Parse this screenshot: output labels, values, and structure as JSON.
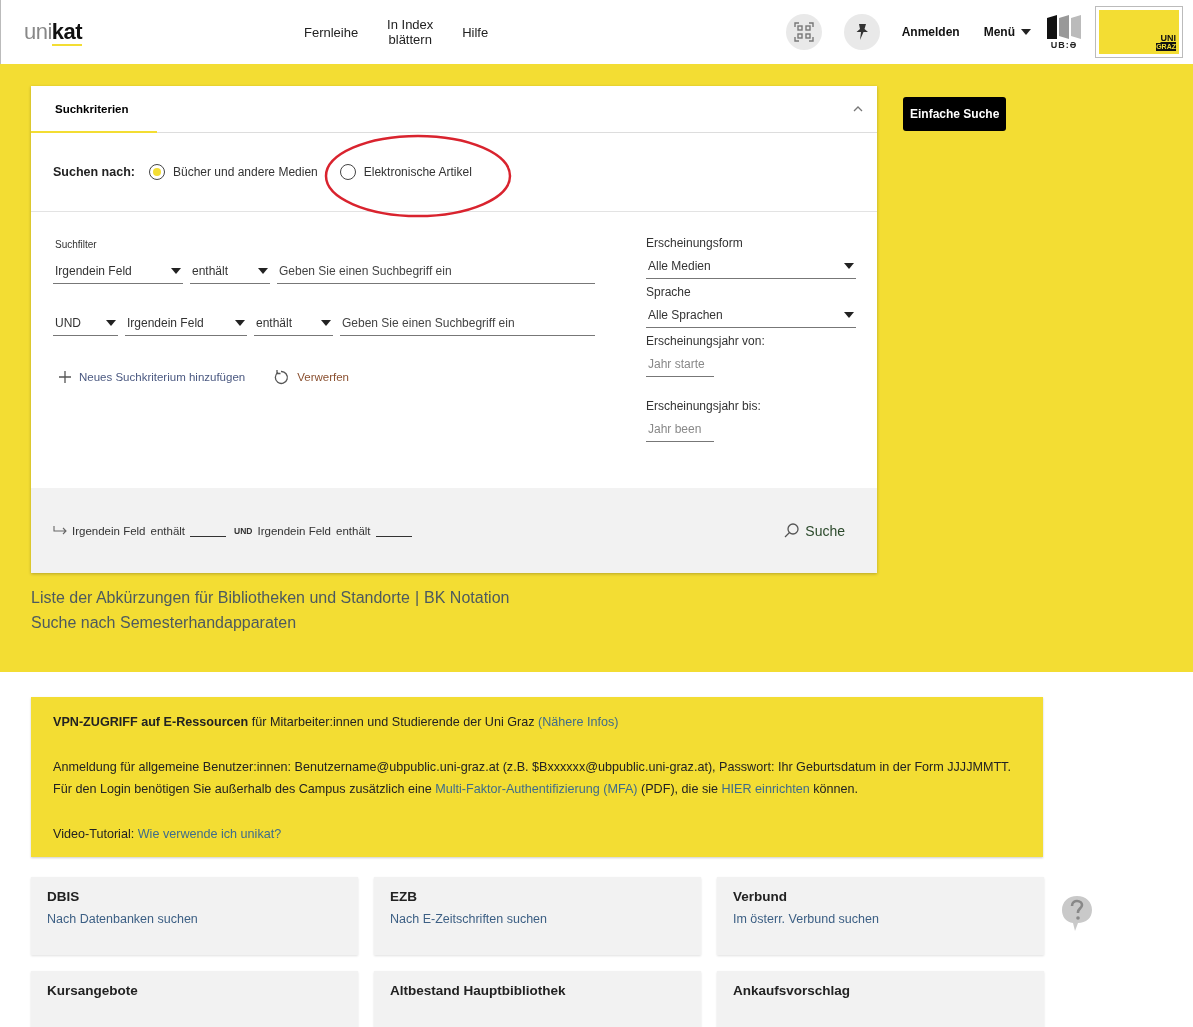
{
  "header": {
    "logo": {
      "light": "uni",
      "bold": "kat"
    },
    "nav": [
      "Fernleihe",
      "In Index blättern",
      "Hilfe"
    ],
    "login": "Anmelden",
    "menu": "Menü",
    "library_logo": "UB:Ə",
    "university_logo": {
      "line_1": "UNI",
      "line_2": "GRAZ"
    }
  },
  "search_card": {
    "tabs": [
      {
        "label": "Suchkriterien",
        "selected": true
      }
    ],
    "expanded": true,
    "search_for": {
      "label": "Suchen nach:",
      "options": [
        {
          "label": "Bücher und andere Medien",
          "selected": true,
          "highlighted": false
        },
        {
          "label": "Elektronische Artikel",
          "selected": false,
          "highlighted": true
        }
      ]
    },
    "filter_label": "Suchfilter",
    "filter_rows": [
      [
        {
          "kind": "select",
          "value": "Irgendein Feld"
        },
        {
          "kind": "select",
          "value": "enthält"
        },
        {
          "kind": "input",
          "placeholder": "Geben Sie einen Suchbegriff ein"
        }
      ],
      [
        {
          "kind": "select",
          "value": "UND"
        },
        {
          "kind": "select",
          "value": "Irgendein Feld"
        },
        {
          "kind": "select",
          "value": "enthält"
        },
        {
          "kind": "input",
          "placeholder": "Geben Sie einen Suchbegriff ein"
        }
      ]
    ],
    "add_criterion": "Neues Suchkriterium hinzufügen",
    "reset": "Verwerfen",
    "facets": [
      {
        "kind": "select",
        "label": "Erscheinungsform",
        "value": "Alle Medien"
      },
      {
        "kind": "select",
        "label": "Sprache",
        "value": "Alle Sprachen"
      },
      {
        "kind": "input",
        "label": "Erscheinungsjahr von:",
        "placeholder": "Jahr starte"
      },
      {
        "kind": "input",
        "label": "Erscheinungsjahr bis:",
        "placeholder": "Jahr been"
      }
    ],
    "summary": [
      {
        "kind": "text",
        "text": "Irgendein Feld"
      },
      {
        "kind": "text",
        "text": "enthält"
      },
      {
        "kind": "blank"
      },
      {
        "kind": "operator",
        "text": "UND"
      },
      {
        "kind": "text",
        "text": "Irgendein Feld"
      },
      {
        "kind": "text",
        "text": "enthält"
      },
      {
        "kind": "blank"
      }
    ],
    "search_button": "Suche"
  },
  "simple_search_button": "Einfache Suche",
  "links": [
    [
      {
        "kind": "link",
        "text": "Liste der Abkürzungen für Bibliotheken und Standorte"
      },
      {
        "kind": "separator",
        "text": "|"
      },
      {
        "kind": "link",
        "text": "BK Notation"
      }
    ],
    [
      {
        "kind": "link",
        "text": "Suche nach Semesterhandapparaten"
      }
    ]
  ],
  "info": [
    [
      {
        "kind": "text",
        "text": "**VPN-ZUGRIFF auf E-Ressourcen** für Mitarbeiter:innen und Studierende der Uni Graz "
      },
      {
        "kind": "link",
        "text": "(Nähere Infos)"
      }
    ],
    [
      {
        "kind": "text",
        "text": "Anmeldung für allgemeine Benutzer:innen: Benutzername@ubpublic.uni-graz.at (z.B. $Bxxxxxx@ubpublic.uni-graz.at), Passwort: Ihr Geburtsdatum in der Form JJJJMMTT. Für den Login benötigen Sie außerhalb des Campus zusätzlich eine "
      },
      {
        "kind": "link",
        "text": "Multi-Faktor-Authentifizierung (MFA)"
      },
      {
        "kind": "text",
        "text": " (PDF), die sie "
      },
      {
        "kind": "link",
        "text": "HIER einrichten"
      },
      {
        "kind": "text",
        "text": " können."
      }
    ],
    [
      {
        "kind": "text",
        "text": "Video-Tutorial: "
      },
      {
        "kind": "link",
        "text": "Wie verwende ich unikat?"
      }
    ]
  ],
  "tiles": [
    {
      "title": "DBIS",
      "link": "Nach Datenbanken suchen"
    },
    {
      "title": "EZB",
      "link": "Nach E-Zeitschriften suchen"
    },
    {
      "title": "Verbund",
      "link": "Im österr. Verbund suchen"
    },
    {
      "title": "Kursangebote"
    },
    {
      "title": "Altbestand Hauptbibliothek"
    },
    {
      "title": "Ankaufsvorschlag"
    }
  ]
}
